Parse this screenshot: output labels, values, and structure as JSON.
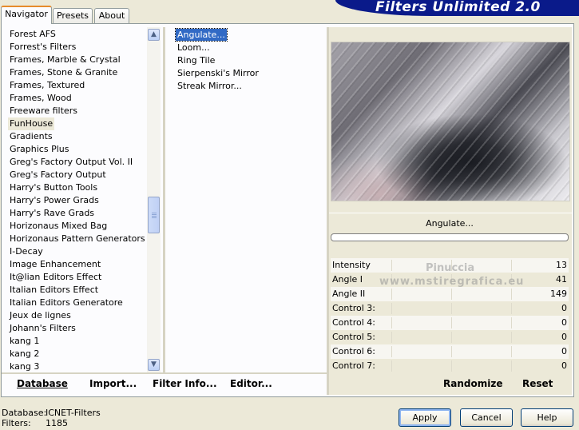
{
  "tabs": [
    {
      "label": "Navigator",
      "active": true
    },
    {
      "label": "Presets",
      "active": false
    },
    {
      "label": "About",
      "active": false
    }
  ],
  "app_title": "Filters Unlimited 2.0",
  "categories": [
    "Forest AFS",
    "Forrest's Filters",
    "Frames, Marble & Crystal",
    "Frames, Stone & Granite",
    "Frames, Textured",
    "Frames, Wood",
    "Freeware filters",
    "FunHouse",
    "Gradients",
    "Graphics Plus",
    "Greg's Factory Output Vol. II",
    "Greg's Factory Output",
    "Harry's Button Tools",
    "Harry's Power Grads",
    "Harry's Rave Grads",
    "Horizonaus Mixed Bag",
    "Horizonaus Pattern Generators",
    "I-Decay",
    "Image Enhancement",
    "It@lian Editors Effect",
    "Italian Editors Effect",
    "Italian Editors Generatore",
    "Jeux de lignes",
    "Johann's Filters",
    "kang 1",
    "kang 2",
    "kang 3"
  ],
  "selected_category": "FunHouse",
  "filters": [
    "Angulate...",
    "Loom...",
    "Ring Tile",
    "Sierpenski's Mirror",
    "Streak Mirror..."
  ],
  "selected_filter": "Angulate...",
  "scroll_icons": {
    "up": "scroll-up-arrow",
    "down": "scroll-down-arrow"
  },
  "bottom_links": {
    "database": "Database",
    "import": "Import...",
    "filter_info": "Filter Info...",
    "editor": "Editor..."
  },
  "preview_label": "Angulate...",
  "controls": [
    {
      "label": "Intensity",
      "value": "13"
    },
    {
      "label": "Angle I",
      "value": "41"
    },
    {
      "label": "Angle II",
      "value": "149"
    },
    {
      "label": "Control 3:",
      "value": "0"
    },
    {
      "label": "Control 4:",
      "value": "0"
    },
    {
      "label": "Control 5:",
      "value": "0"
    },
    {
      "label": "Control 6:",
      "value": "0"
    },
    {
      "label": "Control 7:",
      "value": "0"
    }
  ],
  "actions": {
    "randomize": "Randomize",
    "reset": "Reset"
  },
  "status": {
    "database_label": "Database:",
    "database_value": "ICNET-Filters",
    "filters_label": "Filters:",
    "filters_value": "1185"
  },
  "buttons": {
    "apply": "Apply",
    "cancel": "Cancel",
    "help": "Help"
  },
  "watermark": {
    "line1": "Pinuccia",
    "line2": "www.mstiregrafica.eu"
  },
  "colors": {
    "banner": "#0a1a8a",
    "selection": "#316ac5",
    "tab_accent": "#e68b2c"
  }
}
